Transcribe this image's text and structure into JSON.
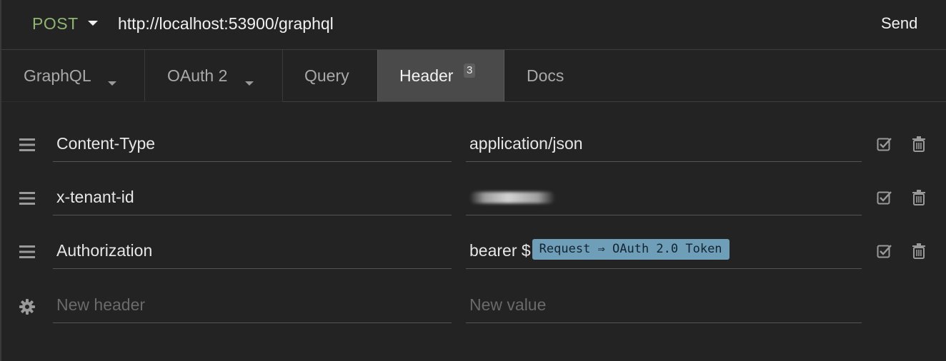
{
  "request": {
    "method": "POST",
    "url": "http://localhost:53900/graphql",
    "send_label": "Send"
  },
  "tabs": [
    {
      "label": "GraphQL",
      "has_dropdown": true
    },
    {
      "label": "OAuth 2",
      "has_dropdown": true
    },
    {
      "label": "Query",
      "has_dropdown": false
    },
    {
      "label": "Header",
      "badge": "3",
      "active": true
    },
    {
      "label": "Docs",
      "has_dropdown": false
    }
  ],
  "headers": [
    {
      "name": "Content-Type",
      "value": "application/json",
      "enabled": true
    },
    {
      "name": "x-tenant-id",
      "value": "",
      "value_redacted": true,
      "enabled": true
    },
    {
      "name": "Authorization",
      "value_prefix": "bearer $",
      "value_tag": "Request ⇒ OAuth 2.0 Token",
      "enabled": true
    }
  ],
  "new_row": {
    "name_placeholder": "New header",
    "value_placeholder": "New value"
  },
  "icons": {
    "method_dropdown": "caret-down-icon",
    "row_handle": "drag-handle-icon",
    "toggle": "checkbox-checked-icon",
    "delete": "trash-icon",
    "settings": "gear-icon"
  },
  "colors": {
    "background": "#232323",
    "method": "#8fb573",
    "active_tab": "#4a4a4a",
    "tag_bg": "#6f9fb8"
  }
}
